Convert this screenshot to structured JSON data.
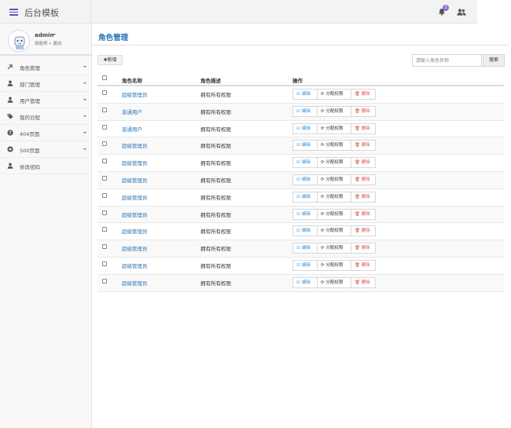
{
  "header": {
    "title": "后台模板",
    "notification_count": "3",
    "menu_icon": "hamburger-icon",
    "bell_icon": "bell-icon",
    "users_icon": "users-icon",
    "accent_color": "#6a4fb0"
  },
  "user": {
    "name": "admin",
    "role": "测验师",
    "dot": "•",
    "logout": "退出"
  },
  "sidebar": {
    "items": [
      {
        "label": "角色管理",
        "icon": "tools-icon"
      },
      {
        "label": "部门管理",
        "icon": "user-icon"
      },
      {
        "label": "用户管理",
        "icon": "user-icon"
      },
      {
        "label": "我的日程",
        "icon": "tag-icon"
      },
      {
        "label": "404页面",
        "icon": "question-icon"
      },
      {
        "label": "500页面",
        "icon": "circle-icon"
      },
      {
        "label": "修改密码",
        "icon": "user-icon"
      }
    ]
  },
  "main": {
    "title": "角色管理",
    "add_label": "新增",
    "search_placeholder": "请输入角色名称",
    "search_label": "搜索",
    "columns": [
      "角色名称",
      "角色描述",
      "操作"
    ],
    "actions": {
      "edit": "编辑",
      "assign": "分配权限",
      "delete": "删除"
    },
    "rows": [
      {
        "name": "超级管理员",
        "desc": "拥有所有权限"
      },
      {
        "name": "普通用户",
        "desc": "拥有所有权限"
      },
      {
        "name": "普通用户",
        "desc": "拥有所有权限"
      },
      {
        "name": "超级管理员",
        "desc": "拥有所有权限"
      },
      {
        "name": "超级管理员",
        "desc": "拥有所有权限"
      },
      {
        "name": "超级管理员",
        "desc": "拥有所有权限"
      },
      {
        "name": "超级管理员",
        "desc": "拥有所有权限"
      },
      {
        "name": "超级管理员",
        "desc": "拥有所有权限"
      },
      {
        "name": "超级管理员",
        "desc": "拥有所有权限"
      },
      {
        "name": "超级管理员",
        "desc": "拥有所有权限"
      },
      {
        "name": "超级管理员",
        "desc": "拥有所有权限"
      },
      {
        "name": "超级管理员",
        "desc": "拥有所有权限"
      }
    ]
  }
}
